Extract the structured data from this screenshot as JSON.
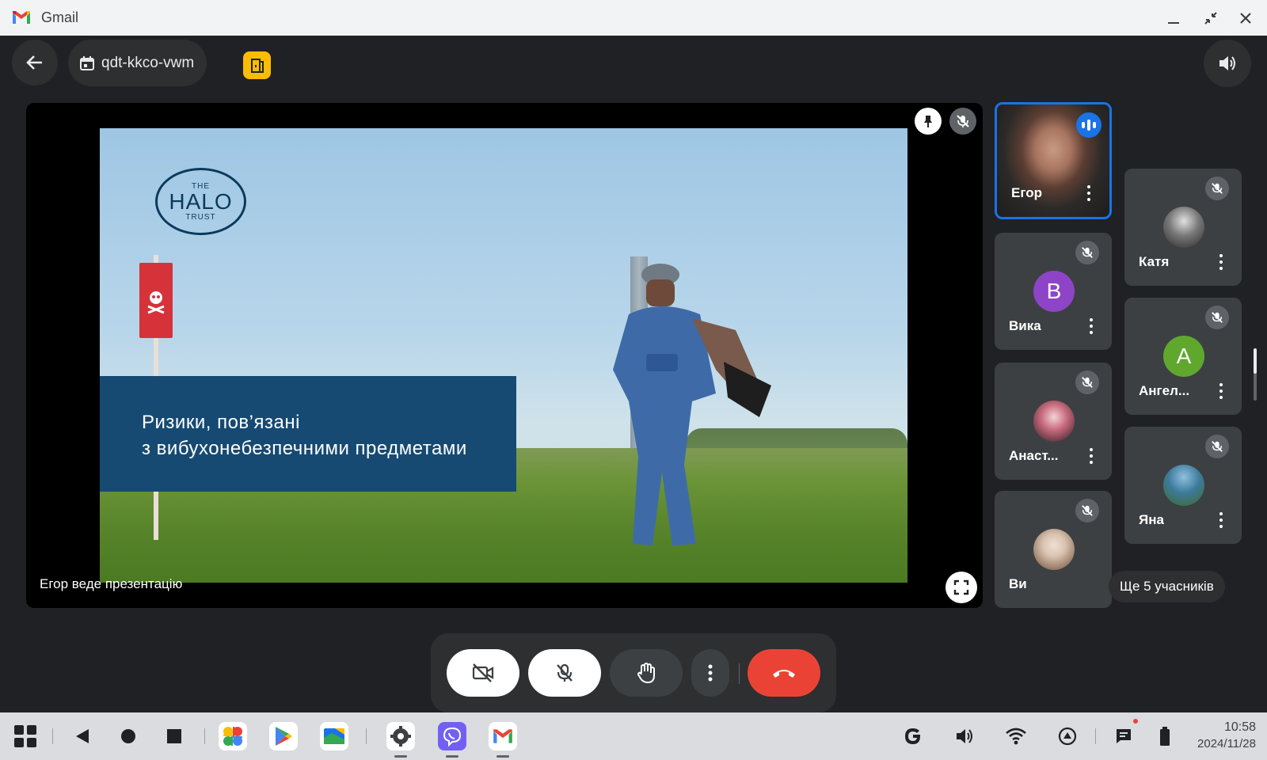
{
  "window": {
    "title": "Gmail",
    "minimize_icon": "minimize-icon",
    "restore_icon": "exit-fullscreen-icon",
    "close_icon": "close-icon"
  },
  "meeting": {
    "code": "qdt-kkco-vwm",
    "back_icon": "arrow-back-icon",
    "calendar_icon": "calendar-icon",
    "room_badge_icon": "companion-mode-icon",
    "audio_icon": "volume-icon"
  },
  "presentation": {
    "logo": {
      "the": "THE",
      "halo": "HALO",
      "trust": "TRUST"
    },
    "caption_line1": "Ризики, пов’язані",
    "caption_line2": "з вибухонебезпечними предметами",
    "presenter_label": "Егор веде презентацію",
    "pin_icon": "pin-icon",
    "mute_icon": "mic-off-icon",
    "fullscreen_icon": "fullscreen-icon"
  },
  "participants": [
    {
      "name": "Егор",
      "state": "speaking",
      "type": "video"
    },
    {
      "name": "Катя",
      "state": "muted",
      "type": "photo",
      "avatar_color": "#9e9e9e"
    },
    {
      "name": "Вика",
      "state": "muted",
      "type": "letter",
      "letter": "В",
      "avatar_color": "#8e44c7"
    },
    {
      "name": "Ангел...",
      "state": "muted",
      "type": "letter",
      "letter": "А",
      "avatar_color": "#5fa82d"
    },
    {
      "name": "Анаст...",
      "state": "muted",
      "type": "photo",
      "avatar_color": "#c86b7e"
    },
    {
      "name": "Яна",
      "state": "muted",
      "type": "photo",
      "avatar_color": "#3d7a9a"
    },
    {
      "name": "Ви",
      "state": "muted",
      "type": "photo",
      "avatar_color": "#d9c3b0"
    }
  ],
  "more_participants": "Ще 5 учасників",
  "controls": {
    "camera_icon": "camera-off-icon",
    "mic_icon": "mic-off-icon",
    "hand_icon": "raise-hand-icon",
    "more_icon": "more-vert-icon",
    "leave_icon": "call-end-icon",
    "colors": {
      "white": "#ffffff",
      "leave": "#ea4335",
      "grey": "#3c4043"
    }
  },
  "taskbar": {
    "launcher_icon": "app-grid-icon",
    "nav_icons": [
      "back-icon",
      "home-icon",
      "recents-icon"
    ],
    "apps": [
      "google-photos-icon",
      "play-store-icon",
      "files-icon",
      "settings-icon",
      "viber-icon",
      "gmail-icon"
    ],
    "tray_icons": [
      "google-icon",
      "volume-icon",
      "wifi-icon",
      "sync-icon",
      "messages-icon",
      "battery-icon"
    ],
    "time": "10:58",
    "date": "2024/11/28"
  },
  "colors": {
    "background": "#202124",
    "accent": "#1a73e8",
    "caption_box": "#164a72",
    "room_badge": "#fbbc04"
  }
}
